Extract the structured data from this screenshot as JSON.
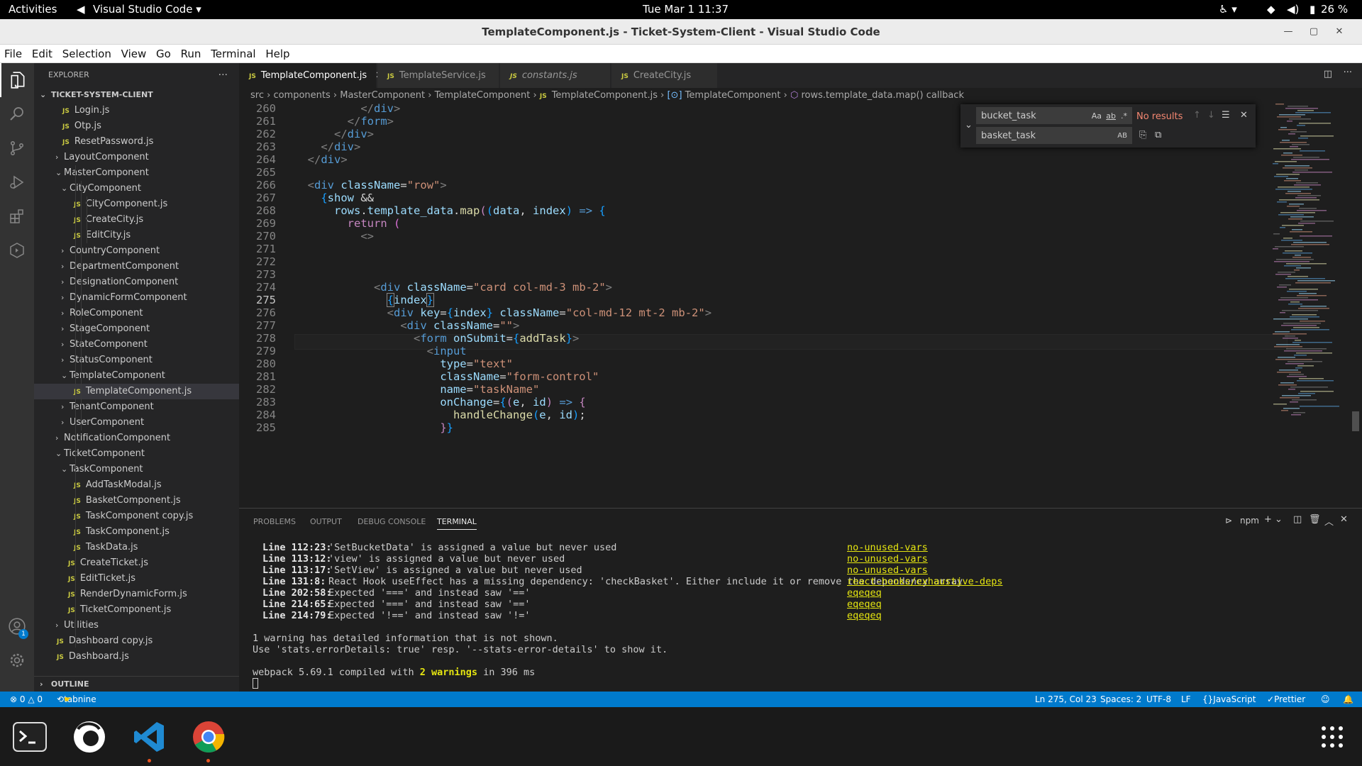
{
  "gnome": {
    "activities": "Activities",
    "app": "Visual Studio Code ▾",
    "clock": "Tue Mar 1  11:37",
    "battery": "26 %"
  },
  "window": {
    "title": "TemplateComponent.js - Ticket-System-Client - Visual Studio Code"
  },
  "menu": [
    "File",
    "Edit",
    "Selection",
    "View",
    "Go",
    "Run",
    "Terminal",
    "Help"
  ],
  "explorer": {
    "header": "EXPLORER",
    "project": "TICKET-SYSTEM-CLIENT",
    "outline": "OUTLINE",
    "items": [
      {
        "label": "Login.js",
        "type": "js",
        "depth": 2
      },
      {
        "label": "Otp.js",
        "type": "js",
        "depth": 2
      },
      {
        "label": "ResetPassword.js",
        "type": "js",
        "depth": 2
      },
      {
        "label": "LayoutComponent",
        "type": "folder",
        "depth": 2,
        "open": false
      },
      {
        "label": "MasterComponent",
        "type": "folder",
        "depth": 2,
        "open": true
      },
      {
        "label": "CityComponent",
        "type": "folder",
        "depth": 3,
        "open": true
      },
      {
        "label": "CityComponent.js",
        "type": "js",
        "depth": 4
      },
      {
        "label": "CreateCity.js",
        "type": "js",
        "depth": 4
      },
      {
        "label": "EditCity.js",
        "type": "js",
        "depth": 4
      },
      {
        "label": "CountryComponent",
        "type": "folder",
        "depth": 3,
        "open": false
      },
      {
        "label": "DepartmentComponent",
        "type": "folder",
        "depth": 3,
        "open": false
      },
      {
        "label": "DesignationComponent",
        "type": "folder",
        "depth": 3,
        "open": false
      },
      {
        "label": "DynamicFormComponent",
        "type": "folder",
        "depth": 3,
        "open": false
      },
      {
        "label": "RoleComponent",
        "type": "folder",
        "depth": 3,
        "open": false
      },
      {
        "label": "StageComponent",
        "type": "folder",
        "depth": 3,
        "open": false
      },
      {
        "label": "StateComponent",
        "type": "folder",
        "depth": 3,
        "open": false
      },
      {
        "label": "StatusComponent",
        "type": "folder",
        "depth": 3,
        "open": false
      },
      {
        "label": "TemplateComponent",
        "type": "folder",
        "depth": 3,
        "open": true
      },
      {
        "label": "TemplateComponent.js",
        "type": "js",
        "depth": 4,
        "selected": true
      },
      {
        "label": "TenantComponent",
        "type": "folder",
        "depth": 3,
        "open": false
      },
      {
        "label": "UserComponent",
        "type": "folder",
        "depth": 3,
        "open": false
      },
      {
        "label": "NotificationComponent",
        "type": "folder",
        "depth": 2,
        "open": false
      },
      {
        "label": "TicketComponent",
        "type": "folder",
        "depth": 2,
        "open": true
      },
      {
        "label": "TaskComponent",
        "type": "folder",
        "depth": 3,
        "open": true
      },
      {
        "label": "AddTaskModal.js",
        "type": "js",
        "depth": 4
      },
      {
        "label": "BasketComponent.js",
        "type": "js",
        "depth": 4
      },
      {
        "label": "TaskComponent copy.js",
        "type": "js",
        "depth": 4
      },
      {
        "label": "TaskComponent.js",
        "type": "js",
        "depth": 4
      },
      {
        "label": "TaskData.js",
        "type": "js",
        "depth": 4
      },
      {
        "label": "CreateTicket.js",
        "type": "js",
        "depth": 3
      },
      {
        "label": "EditTicket.js",
        "type": "js",
        "depth": 3
      },
      {
        "label": "RenderDynamicForm.js",
        "type": "js",
        "depth": 3
      },
      {
        "label": "TicketComponent.js",
        "type": "js",
        "depth": 3
      },
      {
        "label": "Utilities",
        "type": "folder",
        "depth": 2,
        "open": false
      },
      {
        "label": "Dashboard copy.js",
        "type": "js",
        "depth": 1
      },
      {
        "label": "Dashboard.js",
        "type": "js",
        "depth": 1
      }
    ]
  },
  "tabs": [
    {
      "label": "TemplateComponent.js",
      "active": true,
      "italic": false
    },
    {
      "label": "TemplateService.js",
      "active": false,
      "italic": false
    },
    {
      "label": "constants.js",
      "active": false,
      "italic": true
    },
    {
      "label": "CreateCity.js",
      "active": false,
      "italic": false
    }
  ],
  "breadcrumb": [
    "src",
    "components",
    "MasterComponent",
    "TemplateComponent",
    "TemplateComponent.js",
    "TemplateComponent",
    "rows.template_data.map() callback"
  ],
  "find": {
    "search": "bucket_task",
    "replace": "basket_task",
    "result": "No results",
    "case_opt": "Aa",
    "word_opt": "ab",
    "regex_opt": ".*",
    "preserve_case": "AB"
  },
  "editor": {
    "line_numbers": [
      "260",
      "261",
      "262",
      "263",
      "264",
      "265",
      "266",
      "267",
      "268",
      "269",
      "270",
      "271",
      "272",
      "273",
      "274",
      "275",
      "276",
      "277",
      "278",
      "279",
      "280",
      "281",
      "282",
      "283",
      "284",
      "285"
    ],
    "current_line": "275"
  },
  "panel": {
    "tabs": [
      "PROBLEMS",
      "OUTPUT",
      "DEBUG CONSOLE",
      "TERMINAL"
    ],
    "active": "TERMINAL",
    "terminal_profile": "npm",
    "lint": [
      {
        "loc": "Line 112:23:",
        "msg": "'SetBucketData' is assigned a value but never used",
        "rule": "no-unused-vars"
      },
      {
        "loc": "Line 113:12:",
        "msg": "'view' is assigned a value but never used",
        "rule": "no-unused-vars"
      },
      {
        "loc": "Line 113:17:",
        "msg": "'SetView' is assigned a value but never used",
        "rule": "no-unused-vars"
      },
      {
        "loc": "Line 131:8:",
        "msg": "React Hook useEffect has a missing dependency: 'checkBasket'. Either include it or remove the dependency array",
        "rule": "react-hooks/exhaustive-deps"
      },
      {
        "loc": "Line 202:58:",
        "msg": "Expected '===' and instead saw '=='",
        "rule": "eqeqeq"
      },
      {
        "loc": "Line 214:65:",
        "msg": "Expected '===' and instead saw '=='",
        "rule": "eqeqeq"
      },
      {
        "loc": "Line 214:79:",
        "msg": "Expected '!==' and instead saw '!='",
        "rule": "eqeqeq"
      }
    ],
    "note1": "1 warning has detailed information that is not shown.",
    "note2": "Use 'stats.errorDetails: true' resp. '--stats-error-details' to show it.",
    "compiled_prefix": "webpack 5.69.1 compiled with ",
    "compiled_warn": "2 warnings",
    "compiled_suffix": " in 396 ms"
  },
  "status": {
    "errors": "0",
    "warnings": "0",
    "tabnine": "tabnine",
    "position": "Ln 275, Col 23",
    "spaces": "Spaces: 2",
    "encoding": "UTF-8",
    "eol": "LF",
    "language": "JavaScript",
    "prettier": "Prettier",
    "account_badge": "1"
  },
  "colors": {
    "accent": "#007acc",
    "editor_bg": "#1e1e1e",
    "sidebar_bg": "#252526",
    "activity_bg": "#333333"
  }
}
